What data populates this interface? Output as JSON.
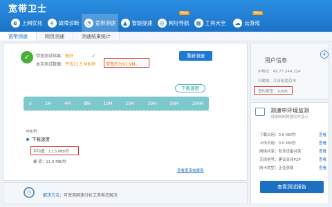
{
  "app": {
    "title": "宽带卫士"
  },
  "nav": [
    {
      "label": "上网优化",
      "icon": "globe-icon",
      "new": false
    },
    {
      "label": "故障诊断",
      "icon": "plus-cross-icon",
      "new": false
    },
    {
      "label": "宽带测速",
      "icon": "speed-icon",
      "new": false,
      "active": true
    },
    {
      "label": "智能提速",
      "icon": "rocket-icon",
      "new": false
    },
    {
      "label": "网址导航",
      "icon": "compass-icon",
      "new": true
    },
    {
      "label": "工具大全",
      "icon": "toolbox-icon",
      "new": false
    },
    {
      "label": "云游戏",
      "icon": "cloud-icon",
      "new": true
    }
  ],
  "nav_badge": "New",
  "tabs": [
    "宽带测速",
    "网页测速",
    "测速结果统计"
  ],
  "result": {
    "line1_label": "带宽测试结果：",
    "line1_value": "很好",
    "line2_label": "本次测试数据：",
    "line2_value": "平均11.5 MB/秒",
    "equiv": "带宽约为91.9M。"
  },
  "retest_label": "重新测速",
  "speed_tag": "下载速度",
  "gauge_ticks": [
    "0",
    "2M",
    "4M",
    "8M",
    "10M",
    "20M",
    "30M",
    "50M",
    "100M"
  ],
  "download": {
    "title": "下载速度",
    "avg": "平均值：11.5 MB/秒",
    "peak": "峰  值：11.6 MB/秒",
    "left_axis": "MB/秒"
  },
  "chart_link": "查看宽带效果表",
  "tip": {
    "label": "解决方法：",
    "text": "可使用网速分析工具帮您解决"
  },
  "user": {
    "title": "用户信息",
    "ip": "IP地址：49.77.244.124",
    "region": "归属地：江苏省南京市",
    "bandwidth": "签约带宽：100M"
  },
  "monitor": {
    "title": "测速中环境监测",
    "subtitle": "测速网络数据实时显示",
    "rows": [
      {
        "label": "下载占用：",
        "value": "0.0 KB/秒",
        "link": "查看"
      },
      {
        "label": "上传占用：",
        "value": "0.0 KB/秒",
        "link": "查看"
      },
      {
        "label": "网络共享：",
        "value": "有多设备共享",
        "link": "查看"
      },
      {
        "label": "无线信号：",
        "value": "建议关闭P2P",
        "link": "查看"
      },
      {
        "label": "网卡类型：",
        "value": "正在获取",
        "link": "查看"
      }
    ]
  },
  "report_label": "查看测试报告"
}
